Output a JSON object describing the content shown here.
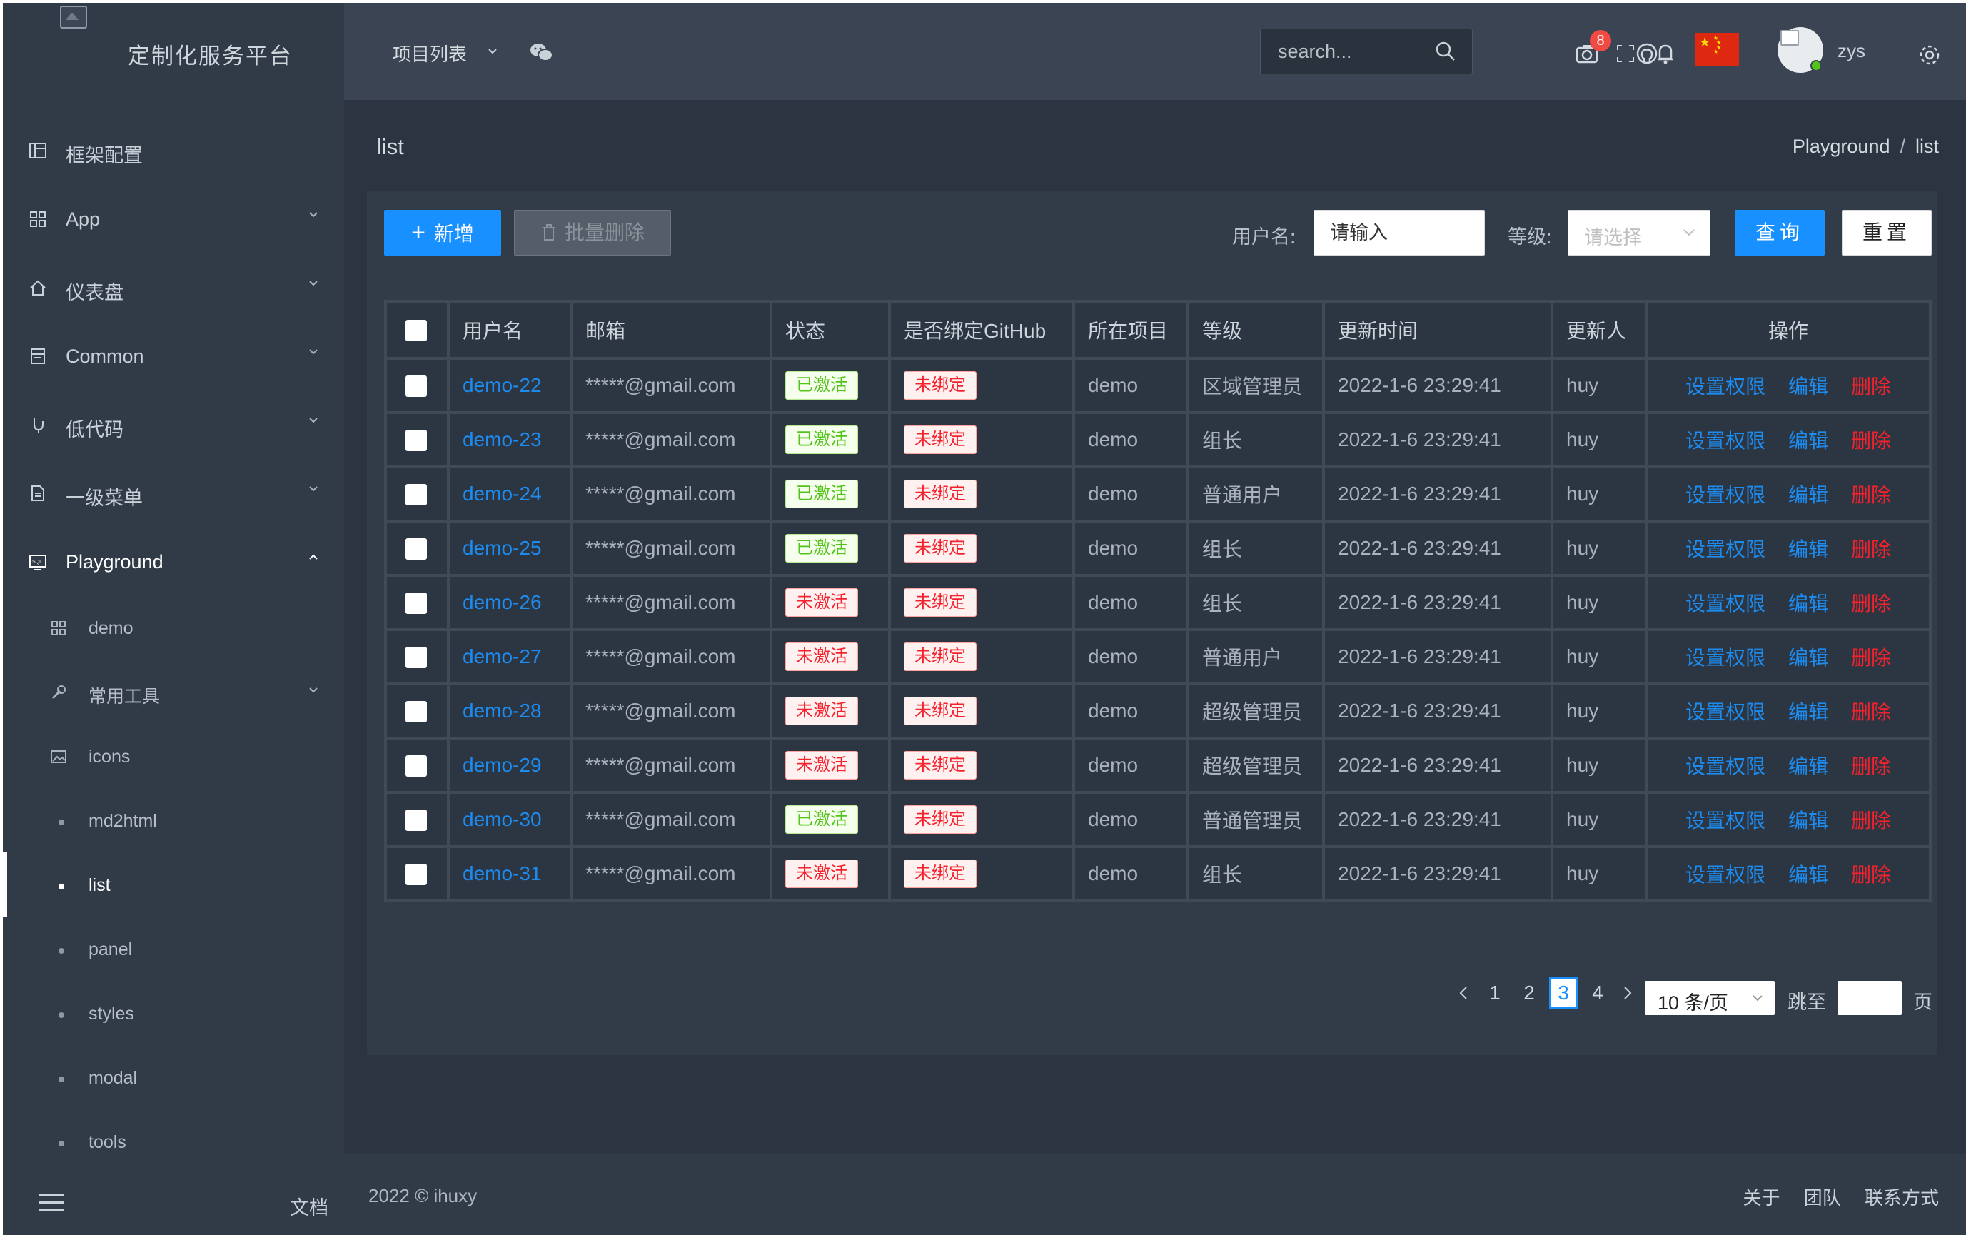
{
  "app": {
    "title": "定制化服务平台"
  },
  "sidebar": {
    "items": [
      {
        "label": "框架配置",
        "icon": "layout-icon"
      },
      {
        "label": "App",
        "icon": "apps-icon"
      },
      {
        "label": "仪表盘",
        "icon": "home-icon"
      },
      {
        "label": "Common",
        "icon": "calculator-icon"
      },
      {
        "label": "低代码",
        "icon": "code-icon"
      },
      {
        "label": "一级菜单",
        "icon": "file-icon"
      },
      {
        "label": "Playground",
        "icon": "sql-icon"
      }
    ],
    "sub_items": [
      {
        "label": "demo"
      },
      {
        "label": "常用工具"
      },
      {
        "label": "icons"
      },
      {
        "label": "md2html"
      },
      {
        "label": "list"
      },
      {
        "label": "panel"
      },
      {
        "label": "styles"
      },
      {
        "label": "modal"
      },
      {
        "label": "tools"
      }
    ],
    "docs_label": "文档"
  },
  "header": {
    "projects_label": "项目列表",
    "search_placeholder": "search...",
    "notification_count": "8",
    "username": "zys"
  },
  "page": {
    "title": "list",
    "breadcrumb": [
      "Playground",
      "list"
    ]
  },
  "toolbar": {
    "add_label": "新增",
    "batch_delete_label": "批量删除",
    "username_label": "用户名:",
    "username_placeholder": "请输入",
    "level_label": "等级:",
    "level_placeholder": "请选择",
    "query_label": "查询",
    "reset_label": "重置"
  },
  "table": {
    "columns": [
      "用户名",
      "邮箱",
      "状态",
      "是否绑定GitHub",
      "所在项目",
      "等级",
      "更新时间",
      "更新人",
      "操作"
    ],
    "actions": [
      "设置权限",
      "编辑",
      "删除"
    ],
    "rows": [
      {
        "username": "demo-22",
        "email": "*****@gmail.com",
        "status": "已激活",
        "github": "未绑定",
        "project": "demo",
        "level": "区域管理员",
        "updated": "2022-1-6 23:29:41",
        "updater": "huy"
      },
      {
        "username": "demo-23",
        "email": "*****@gmail.com",
        "status": "已激活",
        "github": "未绑定",
        "project": "demo",
        "level": "组长",
        "updated": "2022-1-6 23:29:41",
        "updater": "huy"
      },
      {
        "username": "demo-24",
        "email": "*****@gmail.com",
        "status": "已激活",
        "github": "未绑定",
        "project": "demo",
        "level": "普通用户",
        "updated": "2022-1-6 23:29:41",
        "updater": "huy"
      },
      {
        "username": "demo-25",
        "email": "*****@gmail.com",
        "status": "已激活",
        "github": "未绑定",
        "project": "demo",
        "level": "组长",
        "updated": "2022-1-6 23:29:41",
        "updater": "huy"
      },
      {
        "username": "demo-26",
        "email": "*****@gmail.com",
        "status": "未激活",
        "github": "未绑定",
        "project": "demo",
        "level": "组长",
        "updated": "2022-1-6 23:29:41",
        "updater": "huy"
      },
      {
        "username": "demo-27",
        "email": "*****@gmail.com",
        "status": "未激活",
        "github": "未绑定",
        "project": "demo",
        "level": "普通用户",
        "updated": "2022-1-6 23:29:41",
        "updater": "huy"
      },
      {
        "username": "demo-28",
        "email": "*****@gmail.com",
        "status": "未激活",
        "github": "未绑定",
        "project": "demo",
        "level": "超级管理员",
        "updated": "2022-1-6 23:29:41",
        "updater": "huy"
      },
      {
        "username": "demo-29",
        "email": "*****@gmail.com",
        "status": "未激活",
        "github": "未绑定",
        "project": "demo",
        "level": "超级管理员",
        "updated": "2022-1-6 23:29:41",
        "updater": "huy"
      },
      {
        "username": "demo-30",
        "email": "*****@gmail.com",
        "status": "已激活",
        "github": "未绑定",
        "project": "demo",
        "level": "普通管理员",
        "updated": "2022-1-6 23:29:41",
        "updater": "huy"
      },
      {
        "username": "demo-31",
        "email": "*****@gmail.com",
        "status": "未激活",
        "github": "未绑定",
        "project": "demo",
        "level": "组长",
        "updated": "2022-1-6 23:29:41",
        "updater": "huy"
      }
    ]
  },
  "pagination": {
    "pages": [
      "1",
      "2",
      "3",
      "4"
    ],
    "current": "3",
    "page_size": "10 条/页",
    "jump_label": "跳至",
    "page_suffix": "页"
  },
  "footer": {
    "copyright": "2022 © ihuxy",
    "links": [
      "关于",
      "团队",
      "联系方式"
    ]
  },
  "colors": {
    "primary": "#1890ff",
    "active_green": "#52c41a",
    "danger_red": "#f5222d",
    "sidebar_bg": "#313a47",
    "header_bg": "#3a4452"
  }
}
